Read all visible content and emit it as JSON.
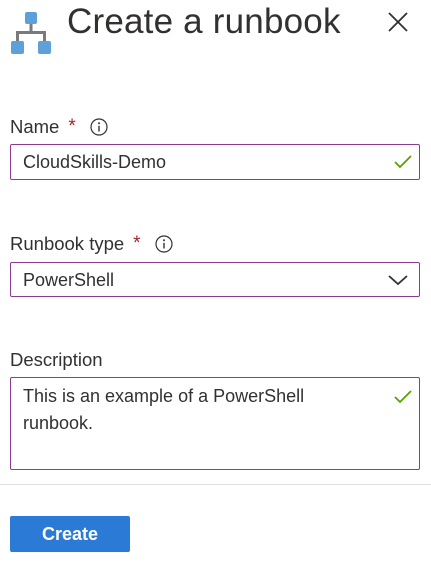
{
  "header": {
    "title": "Create a runbook",
    "icon": "runbook-hierarchy-icon",
    "close_icon": "close-icon"
  },
  "form": {
    "name": {
      "label": "Name",
      "required_marker": "*",
      "value": "CloudSkills-Demo",
      "valid": true
    },
    "runbook_type": {
      "label": "Runbook type",
      "required_marker": "*",
      "selected": "PowerShell"
    },
    "description": {
      "label": "Description",
      "value": "This is an example of a PowerShell runbook.",
      "valid": true
    }
  },
  "footer": {
    "create_label": "Create"
  },
  "colors": {
    "accent": "#2b7bd6",
    "input_border": "#8a3b8f",
    "required": "#a4262c",
    "valid": "#57a300",
    "icon_blue": "#5ea0d8"
  }
}
